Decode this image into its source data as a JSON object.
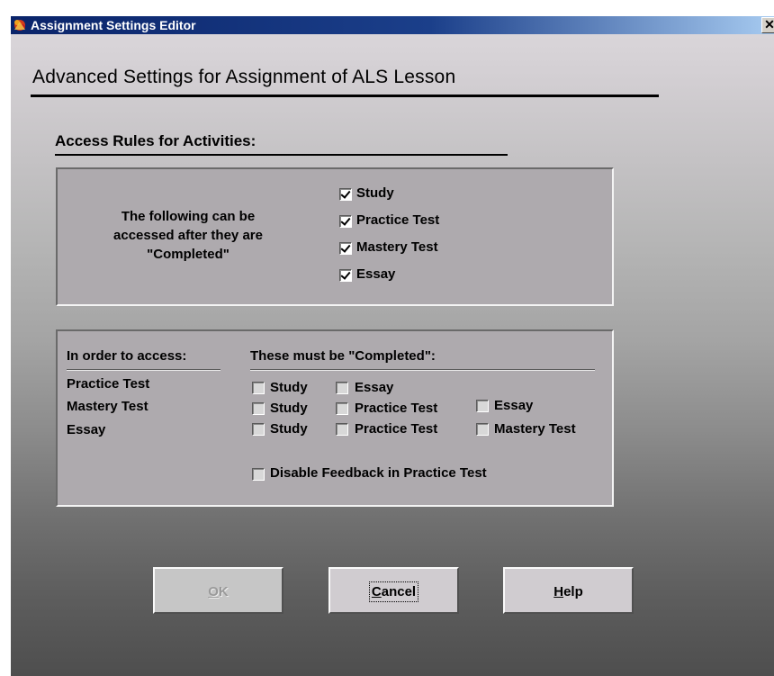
{
  "window": {
    "title": "Assignment Settings Editor",
    "close_glyph": "✕"
  },
  "heading": "Advanced Settings for Assignment of ALS Lesson",
  "access_rules": {
    "title": "Access Rules for Activities:",
    "note_lines": [
      "The following can be",
      "accessed after they are",
      "\"Completed\""
    ],
    "items": [
      {
        "label": "Study",
        "checked": true
      },
      {
        "label": "Practice Test",
        "checked": true
      },
      {
        "label": "Mastery Test",
        "checked": true
      },
      {
        "label": "Essay",
        "checked": true
      }
    ]
  },
  "prereqs": {
    "left_header": "In order to access:",
    "right_header": "These must be \"Completed\":",
    "rows": [
      {
        "target": "Practice Test",
        "options": [
          {
            "label": "Study",
            "checked": false
          },
          {
            "label": "Essay",
            "checked": false
          }
        ]
      },
      {
        "target": "Mastery Test",
        "options": [
          {
            "label": "Study",
            "checked": false
          },
          {
            "label": "Practice Test",
            "checked": false
          },
          {
            "label": "Essay",
            "checked": false
          }
        ]
      },
      {
        "target": "Essay",
        "options": [
          {
            "label": "Study",
            "checked": false
          },
          {
            "label": "Practice Test",
            "checked": false
          },
          {
            "label": "Mastery Test",
            "checked": false
          }
        ]
      }
    ],
    "disable_feedback": {
      "label": "Disable Feedback in Practice Test",
      "checked": false
    }
  },
  "buttons": {
    "ok": {
      "mnemonic": "O",
      "rest": "K",
      "enabled": false
    },
    "cancel": {
      "mnemonic": "C",
      "rest": "ancel",
      "enabled": true
    },
    "help": {
      "mnemonic": "H",
      "rest": "elp",
      "enabled": true
    }
  },
  "icons": {
    "app": "app-logo-icon",
    "close": "close-icon",
    "checkbox": "checkbox-icon"
  }
}
